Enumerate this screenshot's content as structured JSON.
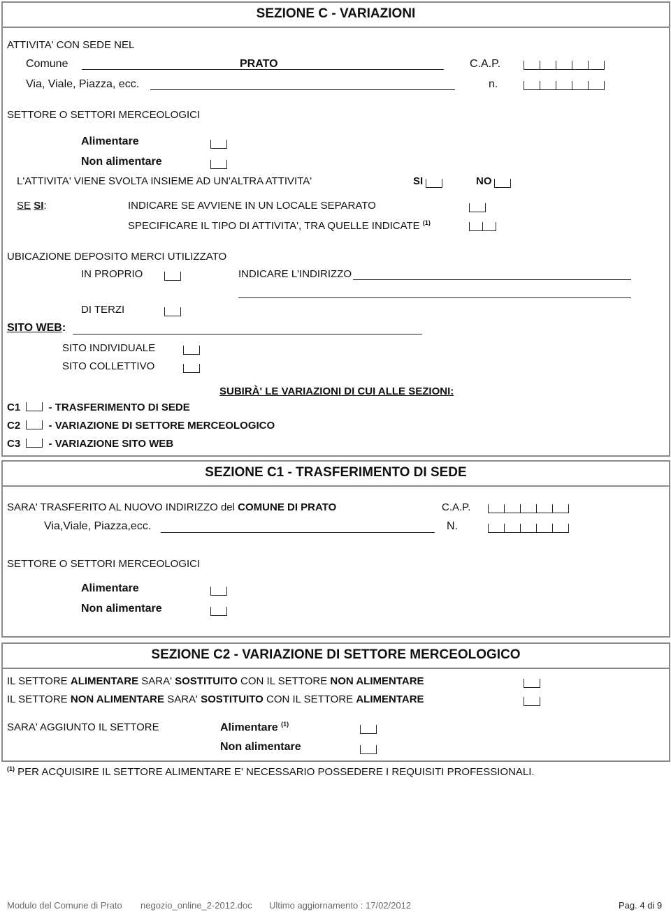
{
  "section_c": {
    "title": "SEZIONE C - VARIAZIONI",
    "sede_label": "ATTIVITA' CON SEDE NEL",
    "comune_label": "Comune",
    "comune_value": "PRATO",
    "cap_label": "C.A.P.",
    "via_label": "Via, Viale, Piazza, ecc.",
    "numero_label": "n.",
    "settori_label": "SETTORE O SETTORI MERCEOLOGICI",
    "alimentare_label": "Alimentare",
    "non_alimentare_label": "Non alimentare",
    "altra_attivita_label": "L'ATTIVITA' VIENE SVOLTA INSIEME AD UN'ALTRA ATTIVITA'",
    "si_label": "SI",
    "no_label": "NO",
    "se_label": "SE",
    "se_si_label": "SI",
    "se_si_suffix": ":",
    "locale_separato_label": "INDICARE SE AVVIENE IN UN LOCALE SEPARATO",
    "tipo_attivita_label": "SPECIFICARE IL TIPO DI ATTIVITA', TRA QUELLE INDICATE",
    "footnote_ref": "(1)",
    "deposito_label": "UBICAZIONE DEPOSITO MERCI UTILIZZATO",
    "in_proprio_label": "IN PROPRIO",
    "indirizzo_label": "INDICARE L'INDIRIZZO",
    "di_terzi_label": "DI TERZI",
    "sito_web_label": "SITO WEB",
    "sito_web_suffix": ":",
    "sito_individuale_label": "SITO INDIVIDUALE",
    "sito_collettivo_label": "SITO COLLETTIVO",
    "subira_label": "SUBIRÀ' LE VARIAZIONI DI CUI ALLE SEZIONI:",
    "variazioni": [
      {
        "code": "C1",
        "label": "- TRASFERIMENTO DI SEDE"
      },
      {
        "code": "C2",
        "label": "- VARIAZIONE DI SETTORE MERCEOLOGICO"
      },
      {
        "code": "C3",
        "label": "- VARIAZIONE SITO WEB"
      }
    ]
  },
  "section_c1": {
    "title": "SEZIONE C1 - TRASFERIMENTO DI SEDE",
    "trasferito_label": "SARA' TRASFERITO AL NUOVO INDIRIZZO del ",
    "comune_bold": "COMUNE DI PRATO",
    "cap_label": "C.A.P.",
    "via_label": "Via,Viale, Piazza,ecc.",
    "numero_label": "N.",
    "settori_label": "SETTORE O SETTORI MERCEOLOGICI",
    "alimentare_label": "Alimentare",
    "non_alimentare_label": "Non alimentare"
  },
  "section_c2": {
    "title": "SEZIONE C2 - VARIAZIONE DI SETTORE MERCEOLOGICO",
    "row1": [
      "IL SETTORE ",
      "ALIMENTARE",
      " SARA' ",
      "SOSTITUITO",
      " CON IL SETTORE ",
      "NON ALIMENTARE"
    ],
    "row2": [
      "IL SETTORE ",
      "NON ALIMENTARE",
      " SARA' ",
      "SOSTITUITO",
      " CON IL SETTORE ",
      "ALIMENTARE"
    ],
    "aggiunto_label": "SARA' AGGIUNTO IL SETTORE",
    "alimentare_label": "Alimentare",
    "footnote_ref": "(1)",
    "non_alimentare_label": "Non alimentare"
  },
  "footnote": {
    "ref": "(1)",
    "text": "PER ACQUISIRE IL SETTORE ALIMENTARE E' NECESSARIO POSSEDERE I REQUISITI PROFESSIONALI."
  },
  "footer": {
    "modulo": "Modulo del Comune di Prato",
    "file": "negozio_online_2-2012.doc",
    "aggiornamento": "Ultimo aggiornamento : 17/02/2012",
    "page": "Pag. 4 di 9"
  }
}
